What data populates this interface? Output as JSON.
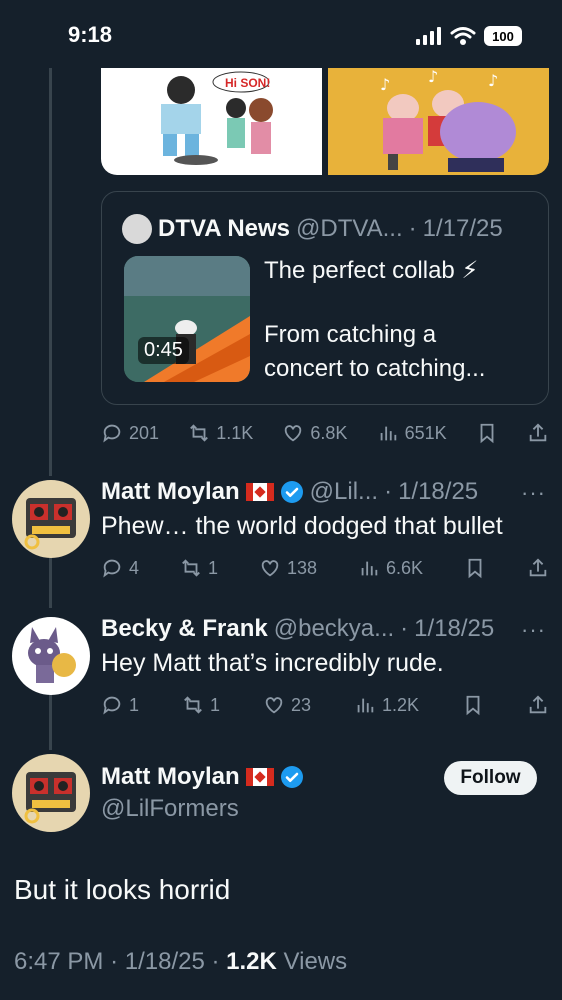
{
  "status_bar": {
    "time": "9:18",
    "battery": "100"
  },
  "quote": {
    "name": "DTVA News",
    "handle": "@DTVA...",
    "dot": "·",
    "date": "1/17/25",
    "duration": "0:45",
    "text_line1": "The perfect collab ⚡",
    "text_line2": "From catching a",
    "text_line3": "concert to catching..."
  },
  "quoted_image": {
    "speech": "Hi SON!"
  },
  "main_post_actions": {
    "replies": "201",
    "reposts": "1.1K",
    "likes": "6.8K",
    "views": "651K"
  },
  "replies": [
    {
      "name": "Matt Moylan",
      "handle": "@Lil...",
      "dot": "·",
      "date": "1/18/25",
      "more": "···",
      "text": "Phew… the world dodged that bullet",
      "replies": "4",
      "reposts": "1",
      "likes": "138",
      "views": "6.6K"
    },
    {
      "name": "Becky & Frank",
      "handle": "@beckya...",
      "dot": "·",
      "date": "1/18/25",
      "more": "···",
      "text": "Hey Matt that’s incredibly rude.",
      "replies": "1",
      "reposts": "1",
      "likes": "23",
      "views": "1.2K"
    }
  ],
  "focused": {
    "name": "Matt Moylan",
    "handle": "@LilFormers",
    "follow_label": "Follow",
    "text": "But it looks horrid",
    "time": "6:47 PM",
    "dot": "·",
    "date": "1/18/25",
    "views_count": "1.2K",
    "views_label": "Views"
  },
  "colors": {
    "background": "#15202b",
    "verified": "#1d9bf0",
    "muted": "#8b98a5",
    "border": "#38444d"
  }
}
